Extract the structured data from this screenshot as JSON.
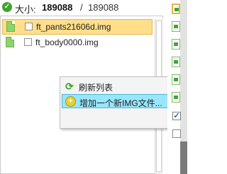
{
  "size": {
    "label": "大小:",
    "current": "189088",
    "separator": "/",
    "total": "189088"
  },
  "files": [
    {
      "name": "ft_pants21606d.img",
      "selected": true
    },
    {
      "name": "ft_body0000.img",
      "selected": false
    }
  ],
  "context_menu": {
    "items": [
      {
        "label": "刷新列表",
        "icon": "refresh-icon",
        "highlighted": false
      },
      {
        "label": "增加一个新IMG文件...",
        "icon": "add-icon",
        "highlighted": true
      }
    ]
  },
  "right_column": {
    "check_mark": "✓"
  },
  "icons": {
    "status": "✓",
    "add": "+",
    "refresh": "⟳"
  },
  "colors": {
    "selection": "#ffdf8a",
    "menu_highlight": "#98e6fb",
    "file_icon": "#8fd36c"
  }
}
